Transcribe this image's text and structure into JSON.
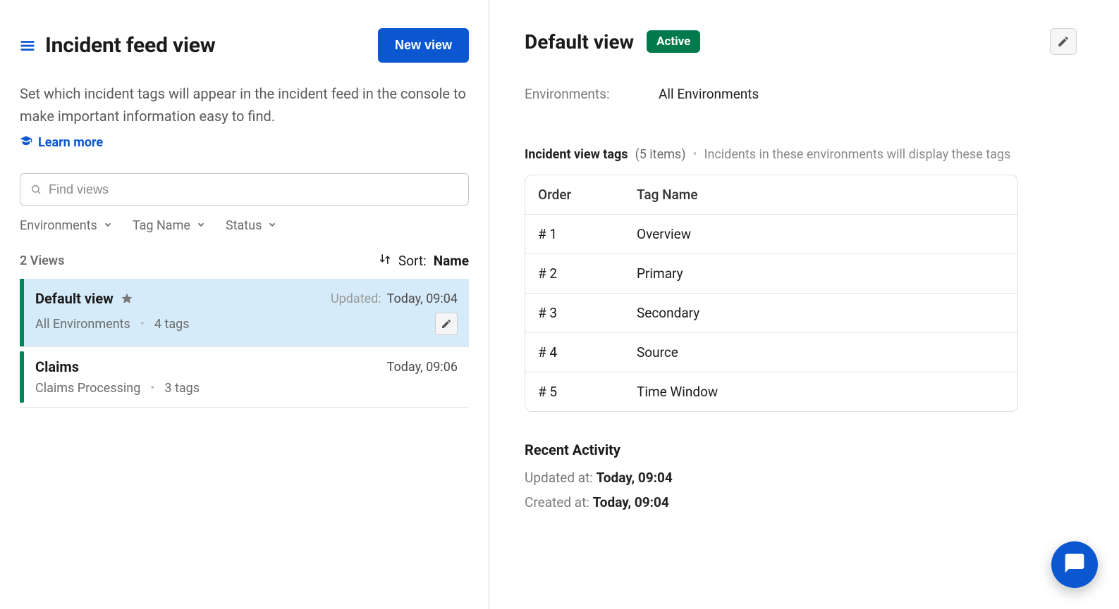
{
  "left": {
    "title": "Incident feed view",
    "new_view_btn": "New view",
    "description": "Set which incident tags will appear in the incident feed in the console to make important information easy to find.",
    "learn_more": "Learn more",
    "search_placeholder": "Find views",
    "filters": {
      "environments": "Environments",
      "tag_name": "Tag Name",
      "status": "Status"
    },
    "views_count": "2 Views",
    "sort_label": "Sort:",
    "sort_value": "Name",
    "views": [
      {
        "name": "Default view",
        "starred": true,
        "env": "All Environments",
        "tags": "4 tags",
        "updated_prefix": "Updated:",
        "time": "Today, 09:04",
        "selected": true
      },
      {
        "name": "Claims",
        "starred": false,
        "env": "Claims Processing",
        "tags": "3 tags",
        "updated_prefix": "",
        "time": "Today, 09:06",
        "selected": false
      }
    ]
  },
  "right": {
    "title": "Default view",
    "status_badge": "Active",
    "env_label": "Environments:",
    "env_value": "All Environments",
    "tags_title": "Incident view tags",
    "tags_count": "(5 items)",
    "tags_hint": "Incidents in these environments will display these tags",
    "table": {
      "headers": {
        "order": "Order",
        "name": "Tag Name"
      },
      "rows": [
        {
          "order": "# 1",
          "name": "Overview"
        },
        {
          "order": "# 2",
          "name": "Primary"
        },
        {
          "order": "# 3",
          "name": "Secondary"
        },
        {
          "order": "# 4",
          "name": "Source"
        },
        {
          "order": "# 5",
          "name": "Time Window"
        }
      ]
    },
    "activity": {
      "title": "Recent Activity",
      "updated_label": "Updated at:",
      "updated_value": "Today, 09:04",
      "created_label": "Created at:",
      "created_value": "Today, 09:04"
    }
  }
}
